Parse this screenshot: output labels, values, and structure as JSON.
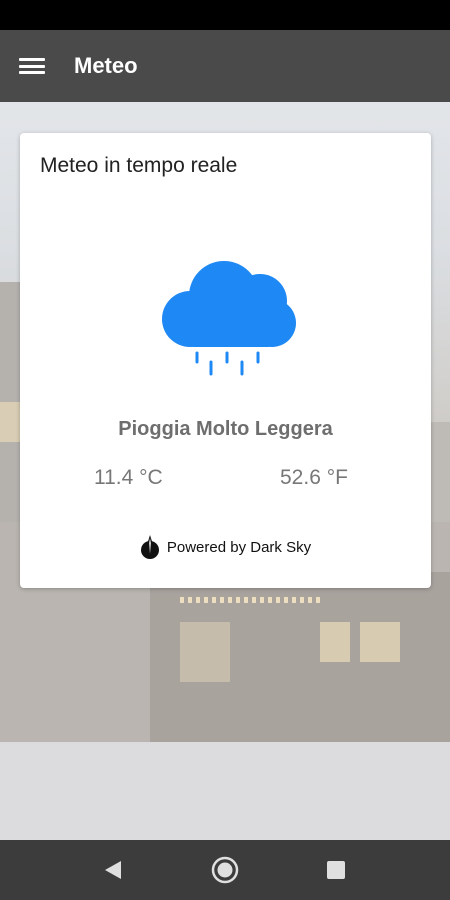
{
  "app_bar": {
    "title": "Meteo",
    "menu_icon": "menu-icon"
  },
  "card": {
    "title": "Meteo in tempo reale",
    "weather_icon": "rain-cloud-icon",
    "condition": "Pioggia Molto Leggera",
    "temp_c": "11.4 °C",
    "temp_f": "52.6 °F",
    "powered_by": "Powered by Dark Sky",
    "powered_icon": "dark-sky-logo-icon"
  },
  "nav_bar": {
    "back_icon": "back-icon",
    "home_icon": "home-icon",
    "recents_icon": "recents-icon"
  },
  "colors": {
    "app_bar": "#4a4a4a",
    "status_bar": "#000000",
    "nav_bar": "#3c3c3c",
    "cloud": "#1e88f5",
    "card": "#ffffff"
  }
}
